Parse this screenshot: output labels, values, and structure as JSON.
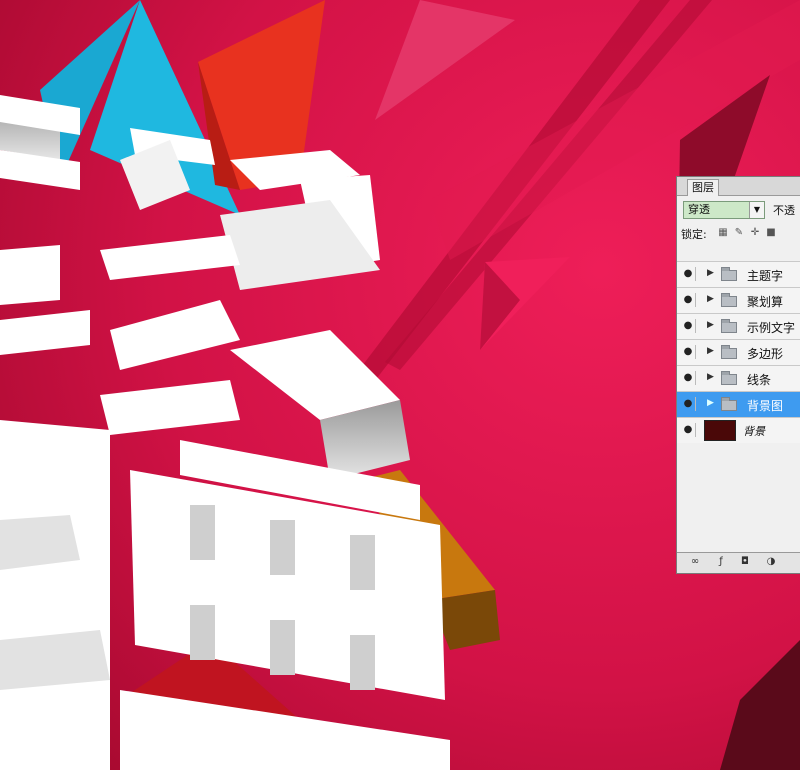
{
  "layers_panel": {
    "tab_label": "图层",
    "blend_mode": "穿透",
    "opacity_label": "不透",
    "lock_label": "锁定:",
    "layers": [
      {
        "name": "主题字",
        "type": "group",
        "visible": true,
        "selected": false
      },
      {
        "name": "聚划算",
        "type": "group",
        "visible": true,
        "selected": false
      },
      {
        "name": "示例文字",
        "type": "group",
        "visible": true,
        "selected": false
      },
      {
        "name": "多边形",
        "type": "group",
        "visible": true,
        "selected": false
      },
      {
        "name": "线条",
        "type": "group",
        "visible": true,
        "selected": false
      },
      {
        "name": "背景图",
        "type": "group",
        "visible": true,
        "selected": true
      },
      {
        "name": "背景",
        "type": "image",
        "visible": true,
        "selected": false
      }
    ]
  },
  "colors": {
    "background": "#d31445",
    "cyan_triangle": "#1fb8e0",
    "orange_triangle": "#c8780e",
    "selection": "#3e9bf0"
  }
}
